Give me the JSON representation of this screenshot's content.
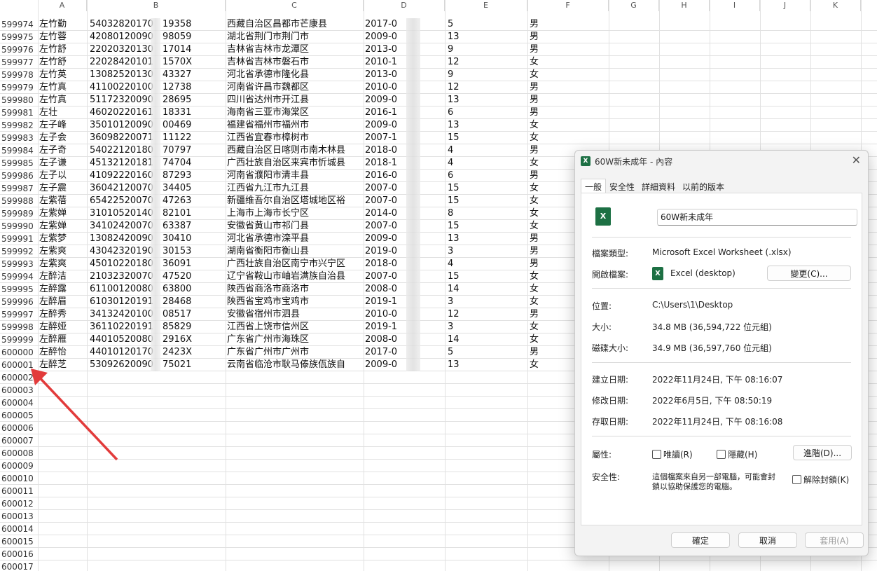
{
  "sheet": {
    "columns": [
      "A",
      "B",
      "C",
      "D",
      "E",
      "F",
      "G",
      "H",
      "I",
      "J",
      "K"
    ],
    "rows": [
      {
        "num": "599974",
        "name": "左竹勤",
        "id": "54032820170",
        "suffix": "19358",
        "addr": "西藏自治区昌都市芒康县",
        "date": "2017-0",
        "n": "5",
        "sex": "男"
      },
      {
        "num": "599975",
        "name": "左竹蓉",
        "id": "42080120090",
        "suffix": "98059",
        "addr": "湖北省荆门市荆门市",
        "date": "2009-0",
        "n": "13",
        "sex": "男"
      },
      {
        "num": "599976",
        "name": "左竹舒",
        "id": "22020320130",
        "suffix": "17014",
        "addr": "吉林省吉林市龙潭区",
        "date": "2013-0",
        "n": "9",
        "sex": "男"
      },
      {
        "num": "599977",
        "name": "左竹舒",
        "id": "22028420101",
        "suffix": "1570X",
        "addr": "吉林省吉林市磐石市",
        "date": "2010-1",
        "n": "12",
        "sex": "女"
      },
      {
        "num": "599978",
        "name": "左竹英",
        "id": "13082520130",
        "suffix": "43327",
        "addr": "河北省承德市隆化县",
        "date": "2013-0",
        "n": "9",
        "sex": "女"
      },
      {
        "num": "599979",
        "name": "左竹真",
        "id": "41100220100",
        "suffix": "12738",
        "addr": "河南省许昌市魏都区",
        "date": "2010-0",
        "n": "12",
        "sex": "男"
      },
      {
        "num": "599980",
        "name": "左竹真",
        "id": "51172320090",
        "suffix": "28695",
        "addr": "四川省达州市开江县",
        "date": "2009-0",
        "n": "13",
        "sex": "男"
      },
      {
        "num": "599981",
        "name": "左壮",
        "id": "46020220161",
        "suffix": "18331",
        "addr": "海南省三亚市海棠区",
        "date": "2016-1",
        "n": "6",
        "sex": "男"
      },
      {
        "num": "599982",
        "name": "左子峰",
        "id": "35010120090",
        "suffix": "00469",
        "addr": "福建省福州市福州市",
        "date": "2009-0",
        "n": "13",
        "sex": "女"
      },
      {
        "num": "599983",
        "name": "左子会",
        "id": "36098220071",
        "suffix": "11122",
        "addr": "江西省宜春市樟树市",
        "date": "2007-1",
        "n": "15",
        "sex": "女"
      },
      {
        "num": "599984",
        "name": "左子奇",
        "id": "54022120180",
        "suffix": "70797",
        "addr": "西藏自治区日喀则市南木林县",
        "date": "2018-0",
        "n": "4",
        "sex": "男"
      },
      {
        "num": "599985",
        "name": "左子谦",
        "id": "45132120181",
        "suffix": "74704",
        "addr": "广西壮族自治区来宾市忻城县",
        "date": "2018-1",
        "n": "4",
        "sex": "女"
      },
      {
        "num": "599986",
        "name": "左子以",
        "id": "41092220160",
        "suffix": "87293",
        "addr": "河南省濮阳市清丰县",
        "date": "2016-0",
        "n": "6",
        "sex": "男"
      },
      {
        "num": "599987",
        "name": "左子震",
        "id": "36042120070",
        "suffix": "34405",
        "addr": "江西省九江市九江县",
        "date": "2007-0",
        "n": "15",
        "sex": "女"
      },
      {
        "num": "599988",
        "name": "左紫蓓",
        "id": "65422520070",
        "suffix": "47263",
        "addr": "新疆维吾尔自治区塔城地区裕",
        "date": "2007-0",
        "n": "15",
        "sex": "女"
      },
      {
        "num": "599989",
        "name": "左紫婵",
        "id": "31010520140",
        "suffix": "82101",
        "addr": "上海市上海市长宁区",
        "date": "2014-0",
        "n": "8",
        "sex": "女"
      },
      {
        "num": "599990",
        "name": "左紫婵",
        "id": "34102420070",
        "suffix": "63387",
        "addr": "安徽省黄山市祁门县",
        "date": "2007-0",
        "n": "15",
        "sex": "女"
      },
      {
        "num": "599991",
        "name": "左紫梦",
        "id": "13082420090",
        "suffix": "30410",
        "addr": "河北省承德市滦平县",
        "date": "2009-0",
        "n": "13",
        "sex": "男"
      },
      {
        "num": "599992",
        "name": "左紫爽",
        "id": "43042320190",
        "suffix": "30153",
        "addr": "湖南省衡阳市衡山县",
        "date": "2019-0",
        "n": "3",
        "sex": "男"
      },
      {
        "num": "599993",
        "name": "左紫爽",
        "id": "45010220180",
        "suffix": "36091",
        "addr": "广西壮族自治区南宁市兴宁区",
        "date": "2018-0",
        "n": "4",
        "sex": "男"
      },
      {
        "num": "599994",
        "name": "左醉洁",
        "id": "21032320070",
        "suffix": "47520",
        "addr": "辽宁省鞍山市岫岩满族自治县",
        "date": "2007-0",
        "n": "15",
        "sex": "女"
      },
      {
        "num": "599995",
        "name": "左醉露",
        "id": "61100120080",
        "suffix": "63800",
        "addr": "陕西省商洛市商洛市",
        "date": "2008-0",
        "n": "14",
        "sex": "女"
      },
      {
        "num": "599996",
        "name": "左醉眉",
        "id": "61030120191",
        "suffix": "28468",
        "addr": "陕西省宝鸡市宝鸡市",
        "date": "2019-1",
        "n": "3",
        "sex": "女"
      },
      {
        "num": "599997",
        "name": "左醉秀",
        "id": "34132420100",
        "suffix": "08517",
        "addr": "安徽省宿州市泗县",
        "date": "2010-0",
        "n": "12",
        "sex": "男"
      },
      {
        "num": "599998",
        "name": "左醉娅",
        "id": "36110220191",
        "suffix": "85829",
        "addr": "江西省上饶市信州区",
        "date": "2019-1",
        "n": "3",
        "sex": "女"
      },
      {
        "num": "599999",
        "name": "左醉雁",
        "id": "44010520080",
        "suffix": "2916X",
        "addr": "广东省广州市海珠区",
        "date": "2008-0",
        "n": "14",
        "sex": "女"
      },
      {
        "num": "600000",
        "name": "左醉怡",
        "id": "44010120170",
        "suffix": "2423X",
        "addr": "广东省广州市广州市",
        "date": "2017-0",
        "n": "5",
        "sex": "男"
      },
      {
        "num": "600001",
        "name": "左醉芝",
        "id": "53092620090",
        "suffix": "75021",
        "addr": "云南省临沧市耿马傣族佤族自",
        "date": "2009-0",
        "n": "13",
        "sex": "女"
      }
    ],
    "empty_rows": [
      "600002",
      "600003",
      "600004",
      "600005",
      "600006",
      "600007",
      "600008",
      "600009",
      "600010",
      "600011",
      "600012",
      "600013",
      "600014",
      "600015",
      "600016",
      "600017"
    ]
  },
  "dialog": {
    "title": "60W新未成年 - 內容",
    "tabs": [
      "一般",
      "安全性",
      "詳細資料",
      "以前的版本"
    ],
    "file_name": "60W新未成年",
    "file_type_label": "檔案類型:",
    "file_type_value": "Microsoft Excel Worksheet (.xlsx)",
    "opens_with_label": "開啟檔案:",
    "opens_with_value": "Excel (desktop)",
    "change_button": "變更(C)...",
    "location_label": "位置:",
    "location_value": "C:\\Users\\1\\Desktop",
    "size_label": "大小:",
    "size_value": "34.8 MB (36,594,722 位元組)",
    "disk_size_label": "磁碟大小:",
    "disk_size_value": "34.9 MB (36,597,760 位元組)",
    "created_label": "建立日期:",
    "created_value": "2022年11月24日, 下午 08:16:07",
    "modified_label": "修改日期:",
    "modified_value": "2022年6月5日, 下午 08:50:19",
    "accessed_label": "存取日期:",
    "accessed_value": "2022年11月24日, 下午 08:16:08",
    "attributes_label": "屬性:",
    "readonly_label": "唯讀(R)",
    "hidden_label": "隱藏(H)",
    "advanced_button": "進階(D)...",
    "security_label": "安全性:",
    "security_text_1": "這個檔案來自另一部電腦，可能會封",
    "security_text_2": "鎖以協助保護您的電腦。",
    "unblock_label": "解除封鎖(K)",
    "ok_button": "確定",
    "cancel_button": "取消",
    "apply_button": "套用(A)"
  },
  "colors": {
    "arrow": "#e23b3b",
    "excel_green": "#1d7044"
  }
}
